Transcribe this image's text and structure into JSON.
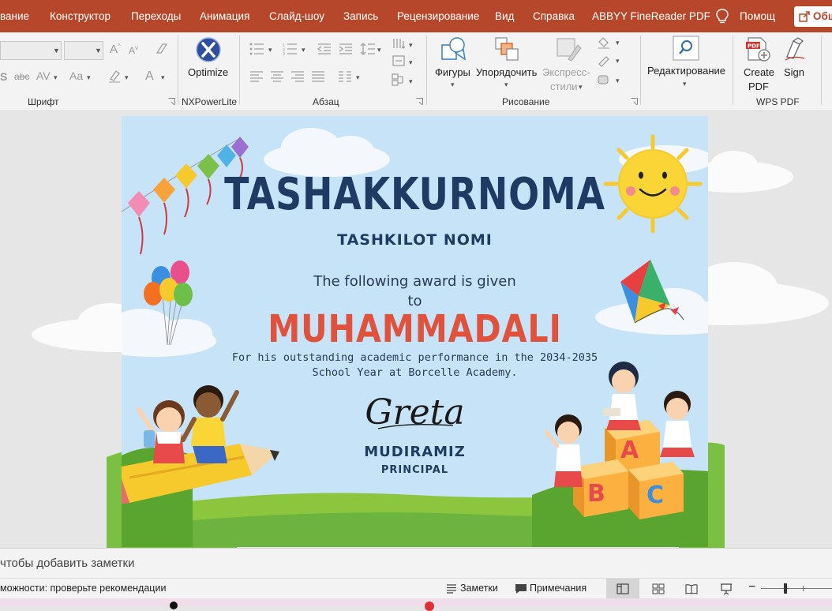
{
  "tabs": [
    "вание",
    "Конструктор",
    "Переходы",
    "Анимация",
    "Слайд-шоу",
    "Запись",
    "Рецензирование",
    "Вид",
    "Справка",
    "ABBYY FineReader PDF"
  ],
  "help_label": "Помощ",
  "share_label": "Общ",
  "ribbon": {
    "groups": {
      "font": "Шрифт",
      "nxpower": "NXPowerLite",
      "paragraph": "Абзац",
      "drawing": "Рисование",
      "wps": "WPS PDF"
    },
    "optimize": "Optimize",
    "shapes": "Фигуры",
    "arrange": "Упорядочить",
    "quick_styles_1": "Экспресс-",
    "quick_styles_2": "стили",
    "editing": "Редактирование",
    "create_pdf_1": "Create",
    "create_pdf_2": "PDF",
    "sign": "Sign",
    "font_chars": {
      "s": "S",
      "abc": "abc",
      "av": "AV",
      "aa": "Aa",
      "a": "A",
      "grow": "A",
      "shrink": "A"
    }
  },
  "slide": {
    "title": "TASHAKKURNOMA",
    "org": "TASHKILOT NOMI",
    "given": "The following award is given",
    "to": "to",
    "name": "MUHAMMADALI",
    "desc1": "For his outstanding academic performance in the 2034-2035",
    "desc2": "School Year at Borcelle Academy.",
    "signature": "Greta",
    "signer": "MUDIRAMIZ",
    "role": "PRINCIPAL",
    "block_letters": [
      "A",
      "B",
      "C"
    ]
  },
  "notes_placeholder": "чтобы добавить заметки",
  "status": {
    "accessibility": "можности: проверьте рекомендации",
    "notes_btn": "Заметки",
    "comments_btn": "Примечания"
  },
  "colors": {
    "accent": "#b7472a",
    "title": "#1f3b63",
    "name": "#e0523c",
    "sky": "#c6e3f8",
    "grass": "#6cb33f"
  }
}
